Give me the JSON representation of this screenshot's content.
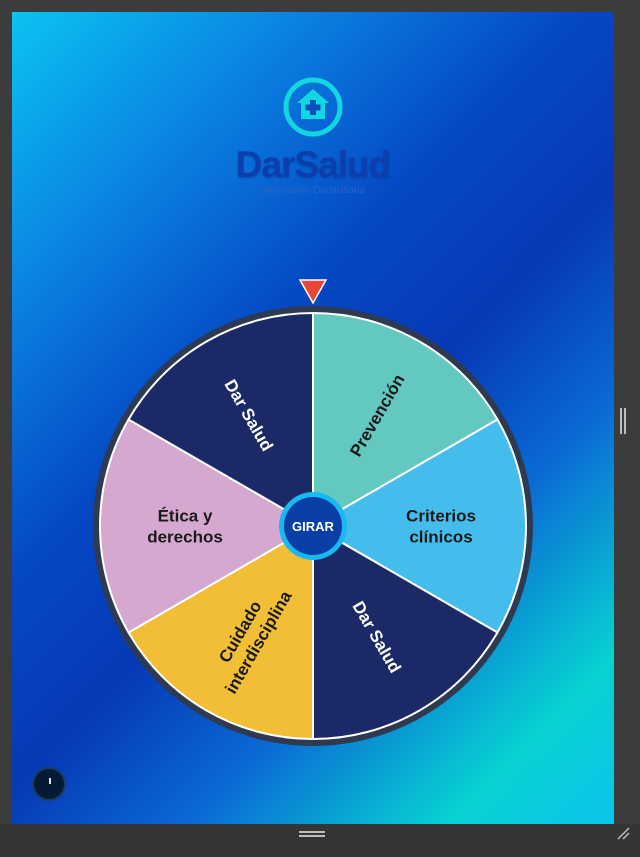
{
  "brand": {
    "name": "DarSalud",
    "tagline": "Internación Domiciliaria",
    "icon": "house-medical-cross-icon"
  },
  "wheel": {
    "spin_label": "GIRAR",
    "segments": [
      {
        "lines": [
          "Prevención"
        ],
        "color": "#62c8c0",
        "text_color": "#1a1a1a"
      },
      {
        "lines": [
          "Criterios",
          "clínicos"
        ],
        "color": "#45bdec",
        "text_color": "#1a1a1a"
      },
      {
        "lines": [
          "Dar Salud"
        ],
        "color": "#1b2a66",
        "text_color": "#ffffff"
      },
      {
        "lines": [
          "Cuidado",
          "interdisciplina"
        ],
        "color": "#f1be36",
        "text_color": "#1a1a1a"
      },
      {
        "lines": [
          "Ética y",
          "derechos"
        ],
        "color": "#d5a8cf",
        "text_color": "#1a1a1a"
      },
      {
        "lines": [
          "Dar Salud"
        ],
        "color": "#1b2a66",
        "text_color": "#ffffff"
      }
    ],
    "rim_color": "#2e3a52",
    "pointer_color": "#e8473a",
    "hub_color": "#0a3fa6",
    "hub_ring_color": "#18b8f0"
  },
  "controls": {
    "sound_icon": "sound-toggle-icon"
  }
}
